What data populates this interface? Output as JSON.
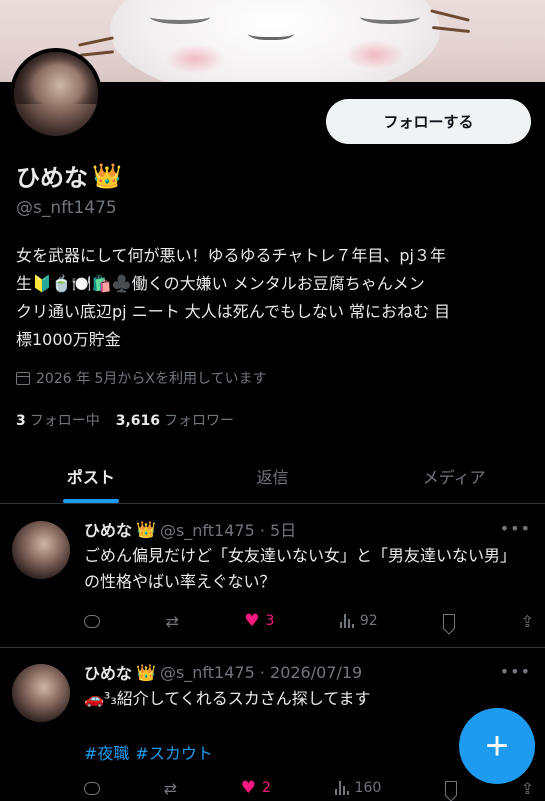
{
  "profile": {
    "name": "ひめな",
    "crown": "👑",
    "handle": "@s_nft1475",
    "follow_label": "フォローする",
    "bio": "女を武器にして何が悪い！ゆるゆるチャトレ７年目、pj３年\n生🔰🍵🍽️🛍️♣️働くの大嫌い メンタルお豆腐ちゃんメン\nクリ通い底辺pj ニート 大人は死んでもしない 常におねむ 目\n標1000万貯金",
    "joined": "2026 年 5月からXを利用しています",
    "following_count": "3",
    "following_label": "フォロー中",
    "followers_count": "3,616",
    "followers_label": "フォロワー"
  },
  "tabs": [
    {
      "label": "ポスト",
      "active": true
    },
    {
      "label": "返信",
      "active": false
    },
    {
      "label": "メディア",
      "active": false
    }
  ],
  "tweets": [
    {
      "name": "ひめな",
      "crown": "👑",
      "meta": "@s_nft1475 · 5日",
      "text": "ごめん偏見だけど「女友達いない女」と「男友達いない男」の性格やばい率えぐない？",
      "likes": "3",
      "views": "92",
      "liked": true
    },
    {
      "name": "ひめな",
      "crown": "👑",
      "meta": "@s_nft1475 · 2026/07/19",
      "text": "🚗³₃紹介してくれるスカさん探してます",
      "tags": [
        "#夜職",
        "#スカウト"
      ],
      "likes": "2",
      "views": "160",
      "liked": true
    }
  ],
  "icons": {
    "more": "more-icon",
    "fab": "compose-plus-icon"
  },
  "colors": {
    "accent": "#1d9bf0",
    "like": "#f91880",
    "background": "#000000",
    "secondary_text": "#71767b"
  }
}
